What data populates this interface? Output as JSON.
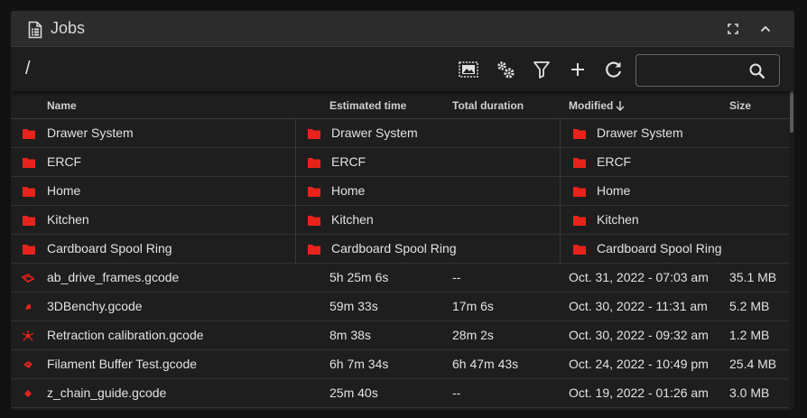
{
  "header": {
    "title": "Jobs"
  },
  "toolbar": {
    "path": "/",
    "search_placeholder": ""
  },
  "columns": {
    "name": "Name",
    "estimated_time": "Estimated time",
    "total_duration": "Total duration",
    "modified": "Modified",
    "size": "Size"
  },
  "folders": [
    {
      "name": "Drawer System"
    },
    {
      "name": "ERCF"
    },
    {
      "name": "Home"
    },
    {
      "name": "Kitchen"
    },
    {
      "name": "Cardboard Spool Ring"
    }
  ],
  "files": [
    {
      "name": "ab_drive_frames.gcode",
      "estimated": "5h 25m 6s",
      "duration": "--",
      "modified": "Oct. 31, 2022 - 07:03 am",
      "size": "35.1 MB"
    },
    {
      "name": "3DBenchy.gcode",
      "estimated": "59m 33s",
      "duration": "17m 6s",
      "modified": "Oct. 30, 2022 - 11:31 am",
      "size": "5.2 MB"
    },
    {
      "name": "Retraction calibration.gcode",
      "estimated": "8m 38s",
      "duration": "28m 2s",
      "modified": "Oct. 30, 2022 - 09:32 am",
      "size": "1.2 MB"
    },
    {
      "name": "Filament Buffer Test.gcode",
      "estimated": "6h 7m 34s",
      "duration": "6h 47m 43s",
      "modified": "Oct. 24, 2022 - 10:49 pm",
      "size": "25.4 MB"
    },
    {
      "name": "z_chain_guide.gcode",
      "estimated": "25m 40s",
      "duration": "--",
      "modified": "Oct. 19, 2022 - 01:26 am",
      "size": "3.0 MB"
    }
  ],
  "colors": {
    "accent": "#e8231b",
    "background": "#1e1e1e",
    "header": "#2c2c2c"
  },
  "icons": {
    "header": "file-document-icon",
    "fullscreen": "fullscreen-icon",
    "collapse": "chevron-up-icon",
    "thumbnails": "image-view-icon",
    "settings": "cogs-icon",
    "filter": "filter-icon",
    "add": "plus-icon",
    "refresh": "refresh-icon",
    "search": "magnify-icon",
    "folder": "folder-icon",
    "file": "gcode-thumbnail-icon"
  }
}
